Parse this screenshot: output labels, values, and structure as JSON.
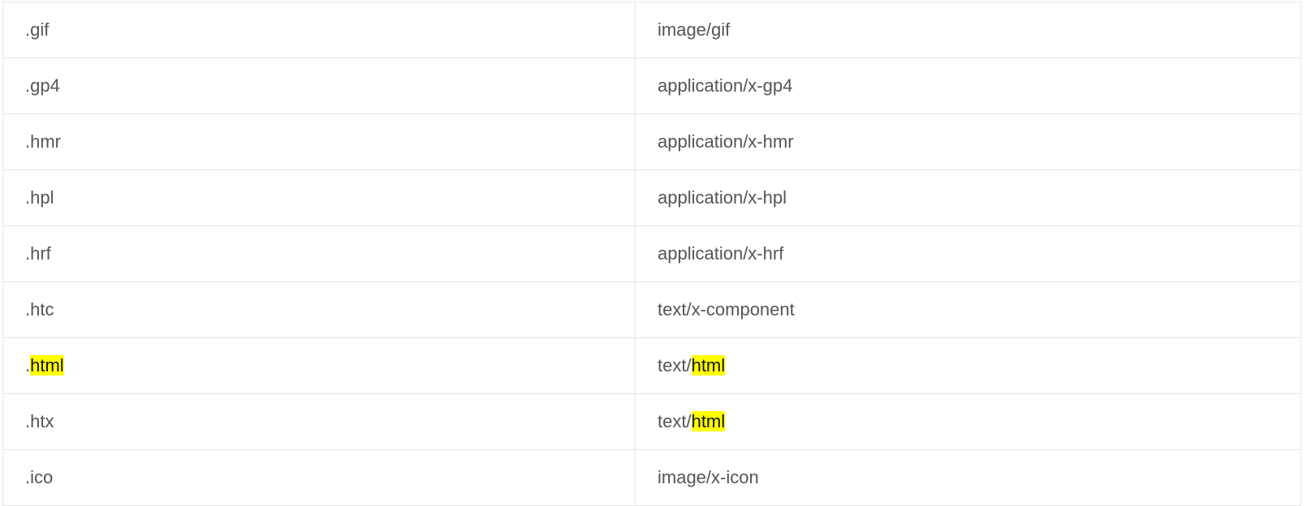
{
  "colors": {
    "text": "#555555",
    "border": "#e6e6e6",
    "highlight": "#ffff00"
  },
  "rows": [
    {
      "ext": [
        {
          "t": ".gif",
          "hl": false
        }
      ],
      "mime": [
        {
          "t": "image/gif",
          "hl": false
        }
      ]
    },
    {
      "ext": [
        {
          "t": ".gp4",
          "hl": false
        }
      ],
      "mime": [
        {
          "t": "application/x-gp4",
          "hl": false
        }
      ]
    },
    {
      "ext": [
        {
          "t": ".hmr",
          "hl": false
        }
      ],
      "mime": [
        {
          "t": "application/x-hmr",
          "hl": false
        }
      ]
    },
    {
      "ext": [
        {
          "t": ".hpl",
          "hl": false
        }
      ],
      "mime": [
        {
          "t": "application/x-hpl",
          "hl": false
        }
      ]
    },
    {
      "ext": [
        {
          "t": ".hrf",
          "hl": false
        }
      ],
      "mime": [
        {
          "t": "application/x-hrf",
          "hl": false
        }
      ]
    },
    {
      "ext": [
        {
          "t": ".htc",
          "hl": false
        }
      ],
      "mime": [
        {
          "t": "text/x-component",
          "hl": false
        }
      ]
    },
    {
      "ext": [
        {
          "t": ".",
          "hl": false
        },
        {
          "t": "html",
          "hl": true
        }
      ],
      "mime": [
        {
          "t": "text/",
          "hl": false
        },
        {
          "t": "html",
          "hl": true
        }
      ]
    },
    {
      "ext": [
        {
          "t": ".htx",
          "hl": false
        }
      ],
      "mime": [
        {
          "t": "text/",
          "hl": false
        },
        {
          "t": "html",
          "hl": true
        }
      ]
    },
    {
      "ext": [
        {
          "t": ".ico",
          "hl": false
        }
      ],
      "mime": [
        {
          "t": "image/x-icon",
          "hl": false
        }
      ]
    }
  ]
}
